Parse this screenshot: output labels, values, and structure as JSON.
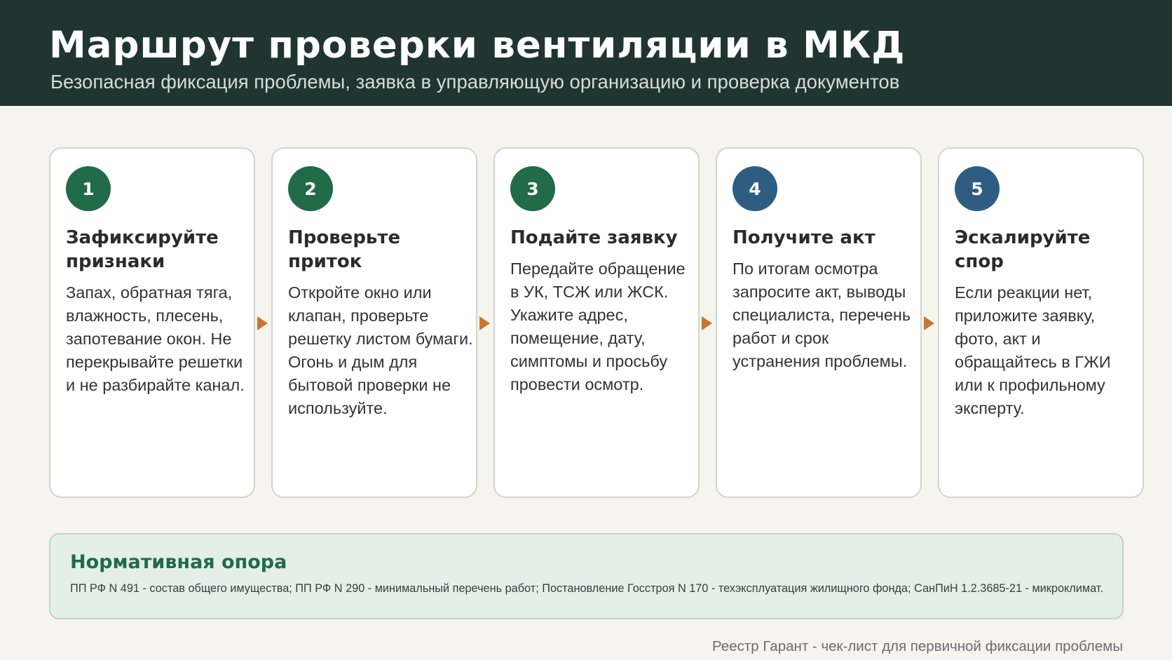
{
  "header": {
    "title": "Маршрут проверки вентиляции в МКД",
    "subtitle": "Безопасная фиксация проблемы, заявка в управляющую организацию и проверка документов"
  },
  "steps": [
    {
      "number": "1",
      "color": "#216b48",
      "title": "Зафиксируйте признаки",
      "text": "Запах, обратная тяга, влажность, плесень, запотевание окон. Не перекрывайте решетки и не разбирайте канал."
    },
    {
      "number": "2",
      "color": "#216b48",
      "title": "Проверьте приток",
      "text": "Откройте окно или клапан, проверьте решетку листом бумаги. Огонь и дым для бытовой проверки не используйте."
    },
    {
      "number": "3",
      "color": "#216b48",
      "title": "Подайте заявку",
      "text": "Передайте обращение в УК, ТСЖ или ЖСК. Укажите адрес, помещение, дату, симптомы и просьбу провести осмотр."
    },
    {
      "number": "4",
      "color": "#2f5d82",
      "title": "Получите акт",
      "text": "По итогам осмотра запросите акт, выводы специалиста, перечень работ и срок устранения проблемы."
    },
    {
      "number": "5",
      "color": "#2f5d82",
      "title": "Эскалируйте спор",
      "text": "Если реакции нет, приложите заявку, фото, акт и обращайтесь в ГЖИ или к профильному эксперту."
    }
  ],
  "arrow_color": "#c9752f",
  "norm": {
    "title": "Нормативная опора",
    "text": "ПП РФ N 491 - состав общего имущества; ПП РФ N 290 - минимальный перечень работ; Постановление Госстроя N 170 - техэксплуатация жилищного фонда; СанПиН 1.2.3685-21 - микроклимат."
  },
  "footer": "Реестр Гарант - чек-лист для первичной фиксации проблемы"
}
